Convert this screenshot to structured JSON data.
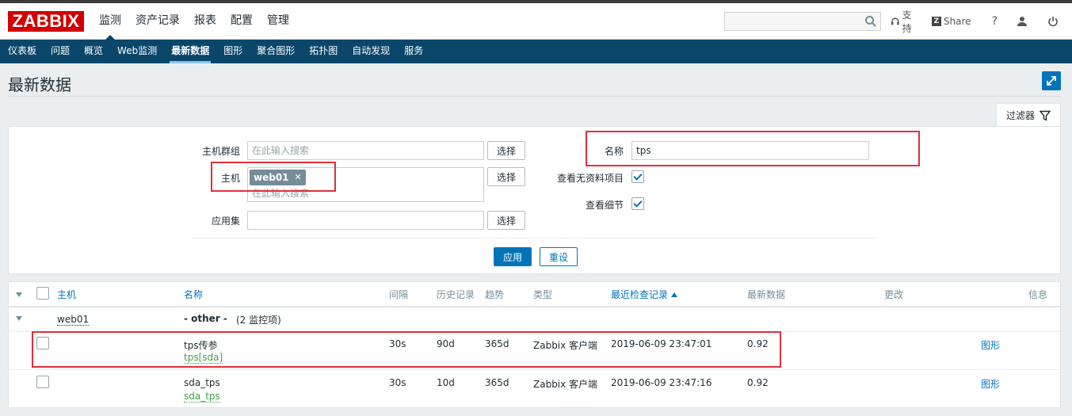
{
  "header": {
    "logo": "ZABBIX",
    "nav": [
      "监测",
      "资产记录",
      "报表",
      "配置",
      "管理"
    ],
    "search_value": "",
    "support_label": "支持",
    "share_label": "Share",
    "help_label": "?"
  },
  "subnav": [
    "仪表板",
    "问题",
    "概览",
    "Web监测",
    "最新数据",
    "图形",
    "聚合图形",
    "拓扑图",
    "自动发现",
    "服务"
  ],
  "page": {
    "title": "最新数据"
  },
  "filter": {
    "tab_label": "过滤器",
    "hostgroup_label": "主机群组",
    "hostgroup_placeholder": "在此输入搜索",
    "host_label": "主机",
    "host_tag": "web01",
    "host_placeholder": "在此输入搜索",
    "application_label": "应用集",
    "application_value": "",
    "select_label": "选择",
    "name_label": "名称",
    "name_value": "tps",
    "show_no_data_label": "查看无资料项目",
    "show_details_label": "查看细节",
    "apply_label": "应用",
    "reset_label": "重设"
  },
  "table": {
    "headers": {
      "host": "主机",
      "name": "名称",
      "interval": "间隔",
      "history": "历史记录",
      "trends": "趋势",
      "type": "类型",
      "last_check": "最近检查记录",
      "last_value": "最新数据",
      "change": "更改",
      "info": "信息"
    },
    "group": {
      "host": "web01",
      "label": "- other -",
      "count": "(2 监控项)"
    },
    "rows": [
      {
        "name": "tps传参",
        "key": "tps[sda]",
        "interval": "30s",
        "history": "90d",
        "trends": "365d",
        "type": "Zabbix 客户端",
        "last_check": "2019-06-09 23:47:01",
        "last_value": "0.92",
        "graph": "图形"
      },
      {
        "name": "sda_tps",
        "key": "sda_tps",
        "interval": "30s",
        "history": "10d",
        "trends": "365d",
        "type": "Zabbix 客户端",
        "last_check": "2019-06-09 23:47:16",
        "last_value": "0.92",
        "graph": "图形"
      }
    ]
  },
  "colors": {
    "nav_bg": "#0a466a",
    "accent": "#0275b8",
    "logo_red": "#d40000",
    "highlight_red": "#e0303a",
    "key_green": "#429e47"
  }
}
